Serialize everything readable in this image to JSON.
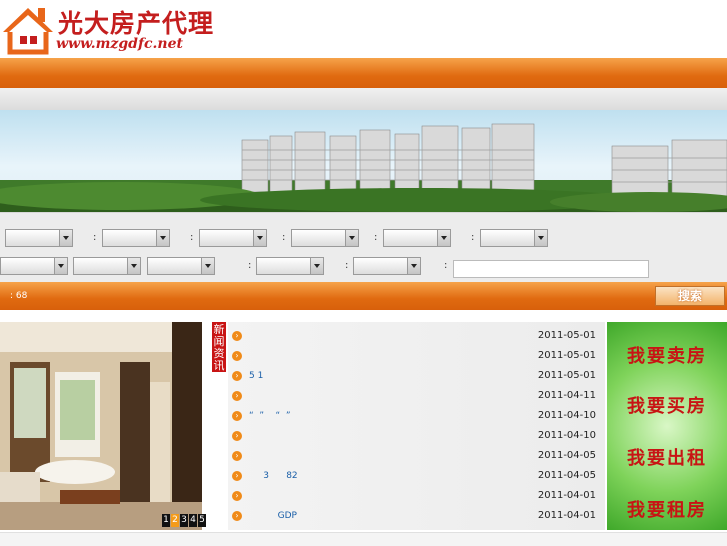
{
  "header": {
    "logo_text": "光大房产代理",
    "logo_url": "www.mzgdfc.net"
  },
  "search": {
    "row1_colons": [
      ":",
      ":",
      ":",
      ":",
      ":"
    ],
    "row2_colons": [
      ":",
      ":",
      ":"
    ],
    "keyword_value": ""
  },
  "bar": {
    "count_text": ": 68",
    "search_button": "搜索"
  },
  "gallery": {
    "pages": [
      "1",
      "2",
      "3",
      "4",
      "5"
    ],
    "active_page": "2"
  },
  "news": {
    "label": "新闻资讯",
    "items": [
      {
        "title": "",
        "date": "2011-05-01"
      },
      {
        "title": "",
        "date": "2011-05-01"
      },
      {
        "title": "5 1",
        "date": "2011-05-01"
      },
      {
        "title": "",
        "date": "2011-04-11"
      },
      {
        "title": "“  ”    “  ”",
        "date": "2011-04-10"
      },
      {
        "title": "",
        "date": "2011-04-10"
      },
      {
        "title": "",
        "date": "2011-04-05"
      },
      {
        "title": "     3      82",
        "date": "2011-04-05"
      },
      {
        "title": "",
        "date": "2011-04-01"
      },
      {
        "title": "          GDP",
        "date": "2011-04-01"
      }
    ]
  },
  "ads": [
    "我要卖房",
    "我要买房",
    "我要出租",
    "我要租房"
  ],
  "colors": {
    "accent": "#e06a10",
    "brand_red": "#c41e1e",
    "link": "#1a5fa8"
  }
}
